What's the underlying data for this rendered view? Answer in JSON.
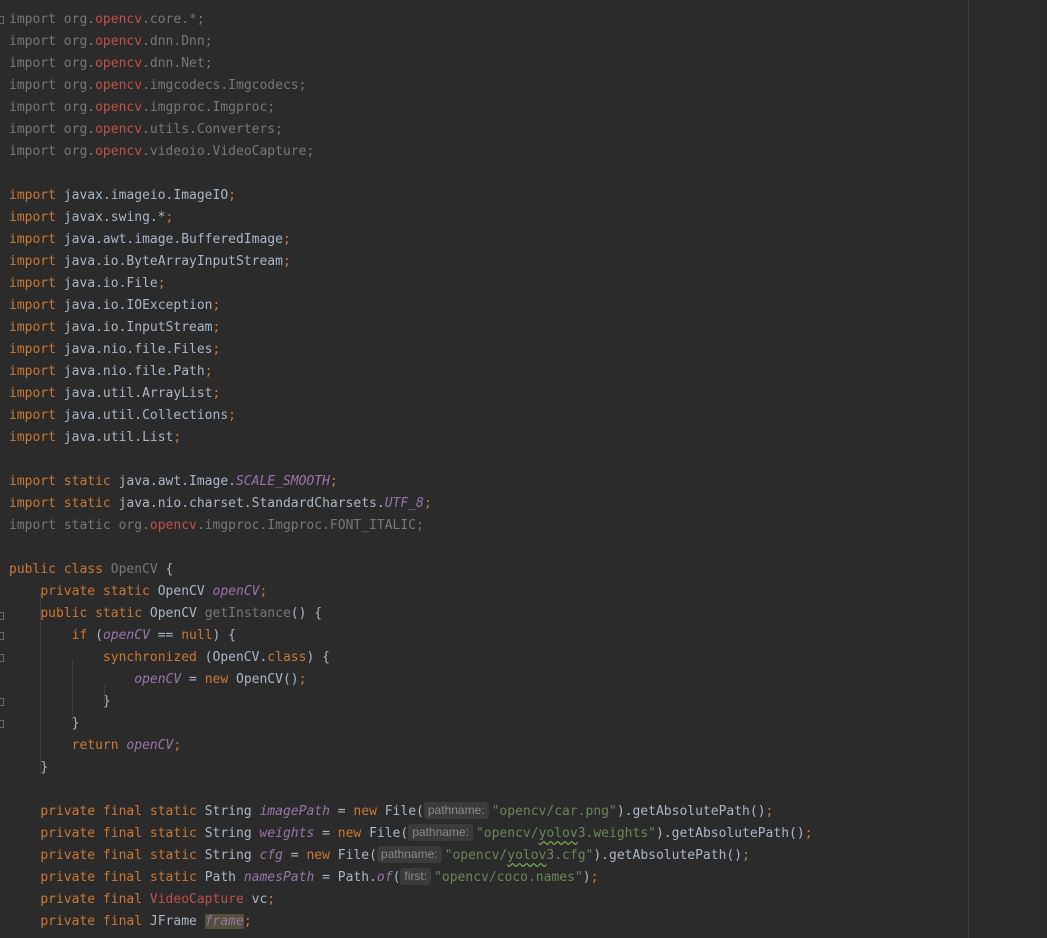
{
  "editor": {
    "lines": [
      [
        {
          "t": "import ",
          "c": "gray"
        },
        {
          "t": "org.",
          "c": "gray"
        },
        {
          "t": "opencv",
          "c": "ocv"
        },
        {
          "t": ".core.*;",
          "c": "gray"
        }
      ],
      [
        {
          "t": "import ",
          "c": "gray"
        },
        {
          "t": "org.",
          "c": "gray"
        },
        {
          "t": "opencv",
          "c": "ocv"
        },
        {
          "t": ".dnn.Dnn;",
          "c": "gray"
        }
      ],
      [
        {
          "t": "import ",
          "c": "gray"
        },
        {
          "t": "org.",
          "c": "gray"
        },
        {
          "t": "opencv",
          "c": "ocv"
        },
        {
          "t": ".dnn.Net;",
          "c": "gray"
        }
      ],
      [
        {
          "t": "import ",
          "c": "gray"
        },
        {
          "t": "org.",
          "c": "gray"
        },
        {
          "t": "opencv",
          "c": "ocv"
        },
        {
          "t": ".imgcodecs.Imgcodecs;",
          "c": "gray"
        }
      ],
      [
        {
          "t": "import ",
          "c": "gray"
        },
        {
          "t": "org.",
          "c": "gray"
        },
        {
          "t": "opencv",
          "c": "ocv"
        },
        {
          "t": ".imgproc.Imgproc;",
          "c": "gray"
        }
      ],
      [
        {
          "t": "import ",
          "c": "gray"
        },
        {
          "t": "org.",
          "c": "gray"
        },
        {
          "t": "opencv",
          "c": "ocv"
        },
        {
          "t": ".utils.Converters;",
          "c": "gray"
        }
      ],
      [
        {
          "t": "import ",
          "c": "gray"
        },
        {
          "t": "org.",
          "c": "gray"
        },
        {
          "t": "opencv",
          "c": "ocv"
        },
        {
          "t": ".videoio.VideoCapture;",
          "c": "gray"
        }
      ],
      [],
      [
        {
          "t": "import ",
          "c": "kw"
        },
        {
          "t": "javax.imageio.ImageIO",
          "c": "txt"
        },
        {
          "t": ";",
          "c": "punc"
        }
      ],
      [
        {
          "t": "import ",
          "c": "kw"
        },
        {
          "t": "javax.swing.*",
          "c": "txt"
        },
        {
          "t": ";",
          "c": "punc"
        }
      ],
      [
        {
          "t": "import ",
          "c": "kw"
        },
        {
          "t": "java.awt.image.BufferedImage",
          "c": "txt"
        },
        {
          "t": ";",
          "c": "punc"
        }
      ],
      [
        {
          "t": "import ",
          "c": "kw"
        },
        {
          "t": "java.io.ByteArrayInputStream",
          "c": "txt"
        },
        {
          "t": ";",
          "c": "punc"
        }
      ],
      [
        {
          "t": "import ",
          "c": "kw"
        },
        {
          "t": "java.io.File",
          "c": "txt"
        },
        {
          "t": ";",
          "c": "punc"
        }
      ],
      [
        {
          "t": "import ",
          "c": "kw"
        },
        {
          "t": "java.io.IOException",
          "c": "txt"
        },
        {
          "t": ";",
          "c": "punc"
        }
      ],
      [
        {
          "t": "import ",
          "c": "kw"
        },
        {
          "t": "java.io.InputStream",
          "c": "txt"
        },
        {
          "t": ";",
          "c": "punc"
        }
      ],
      [
        {
          "t": "import ",
          "c": "kw"
        },
        {
          "t": "java.nio.file.Files",
          "c": "txt"
        },
        {
          "t": ";",
          "c": "punc"
        }
      ],
      [
        {
          "t": "import ",
          "c": "kw"
        },
        {
          "t": "java.nio.file.Path",
          "c": "txt"
        },
        {
          "t": ";",
          "c": "punc"
        }
      ],
      [
        {
          "t": "import ",
          "c": "kw"
        },
        {
          "t": "java.util.ArrayList",
          "c": "txt"
        },
        {
          "t": ";",
          "c": "punc"
        }
      ],
      [
        {
          "t": "import ",
          "c": "kw"
        },
        {
          "t": "java.util.Collections",
          "c": "txt"
        },
        {
          "t": ";",
          "c": "punc"
        }
      ],
      [
        {
          "t": "import ",
          "c": "kw"
        },
        {
          "t": "java.util.List",
          "c": "txt"
        },
        {
          "t": ";",
          "c": "punc"
        }
      ],
      [],
      [
        {
          "t": "import static ",
          "c": "kw"
        },
        {
          "t": "java.awt.Image.",
          "c": "txt"
        },
        {
          "t": "SCALE_SMOOTH",
          "c": "fld"
        },
        {
          "t": ";",
          "c": "punc"
        }
      ],
      [
        {
          "t": "import static ",
          "c": "kw"
        },
        {
          "t": "java.nio.charset.StandardCharsets.",
          "c": "txt"
        },
        {
          "t": "UTF_8",
          "c": "fld"
        },
        {
          "t": ";",
          "c": "punc"
        }
      ],
      [
        {
          "t": "import static ",
          "c": "gray"
        },
        {
          "t": "org.",
          "c": "gray"
        },
        {
          "t": "opencv",
          "c": "ocv"
        },
        {
          "t": ".imgproc.Imgproc.FONT_ITALIC;",
          "c": "gray"
        }
      ],
      [],
      [
        {
          "t": "public class ",
          "c": "kw"
        },
        {
          "t": "OpenCV",
          "c": "gray"
        },
        {
          "t": " {",
          "c": "txt"
        }
      ],
      [
        {
          "t": "    "
        },
        {
          "t": "private static ",
          "c": "kw"
        },
        {
          "t": "OpenCV ",
          "c": "txt"
        },
        {
          "t": "openCV",
          "c": "fld"
        },
        {
          "t": ";",
          "c": "punc"
        }
      ],
      [
        {
          "t": "    "
        },
        {
          "t": "public static ",
          "c": "kw"
        },
        {
          "t": "OpenCV ",
          "c": "txt"
        },
        {
          "t": "getInstance",
          "c": "gray"
        },
        {
          "t": "() {",
          "c": "txt"
        }
      ],
      [
        {
          "t": "        "
        },
        {
          "t": "if ",
          "c": "kw"
        },
        {
          "t": "(",
          "c": "txt"
        },
        {
          "t": "openCV",
          "c": "fld"
        },
        {
          "t": " == ",
          "c": "txt"
        },
        {
          "t": "null",
          "c": "kw"
        },
        {
          "t": ") {",
          "c": "txt"
        }
      ],
      [
        {
          "t": "            "
        },
        {
          "t": "synchronized ",
          "c": "kw"
        },
        {
          "t": "(OpenCV.",
          "c": "txt"
        },
        {
          "t": "class",
          "c": "kw"
        },
        {
          "t": ") {",
          "c": "txt"
        }
      ],
      [
        {
          "t": "                "
        },
        {
          "t": "openCV",
          "c": "fld"
        },
        {
          "t": " = ",
          "c": "txt"
        },
        {
          "t": "new ",
          "c": "kw"
        },
        {
          "t": "OpenCV()",
          "c": "txt"
        },
        {
          "t": ";",
          "c": "punc"
        }
      ],
      [
        {
          "t": "            "
        },
        {
          "t": "}",
          "c": "txt"
        }
      ],
      [
        {
          "t": "        "
        },
        {
          "t": "}",
          "c": "txt"
        }
      ],
      [
        {
          "t": "        "
        },
        {
          "t": "return ",
          "c": "kw"
        },
        {
          "t": "openCV",
          "c": "fld"
        },
        {
          "t": ";",
          "c": "punc"
        }
      ],
      [
        {
          "t": "    "
        },
        {
          "t": "}",
          "c": "txt"
        }
      ],
      [],
      [
        {
          "t": "    "
        },
        {
          "t": "private final static ",
          "c": "kw"
        },
        {
          "t": "String ",
          "c": "txt"
        },
        {
          "t": "imagePath",
          "c": "fld"
        },
        {
          "t": " = ",
          "c": "txt"
        },
        {
          "t": "new ",
          "c": "kw"
        },
        {
          "t": "File(",
          "c": "txt"
        },
        {
          "h": "pathname:"
        },
        {
          "t": "\"opencv/car.png\"",
          "c": "str"
        },
        {
          "t": ").getAbsolutePath()",
          "c": "txt"
        },
        {
          "t": ";",
          "c": "punc"
        }
      ],
      [
        {
          "t": "    "
        },
        {
          "t": "private final static ",
          "c": "kw"
        },
        {
          "t": "String ",
          "c": "txt"
        },
        {
          "t": "weights",
          "c": "fld"
        },
        {
          "t": " = ",
          "c": "txt"
        },
        {
          "t": "new ",
          "c": "kw"
        },
        {
          "t": "File(",
          "c": "txt"
        },
        {
          "h": "pathname:"
        },
        {
          "t": "\"opencv/",
          "c": "str"
        },
        {
          "t": "yolov",
          "c": "str",
          "u": 1
        },
        {
          "t": "3.weights\"",
          "c": "str"
        },
        {
          "t": ").getAbsolutePath()",
          "c": "txt"
        },
        {
          "t": ";",
          "c": "punc"
        }
      ],
      [
        {
          "t": "    "
        },
        {
          "t": "private final static ",
          "c": "kw"
        },
        {
          "t": "String ",
          "c": "txt"
        },
        {
          "t": "cfg",
          "c": "fld"
        },
        {
          "t": " = ",
          "c": "txt"
        },
        {
          "t": "new ",
          "c": "kw"
        },
        {
          "t": "File(",
          "c": "txt"
        },
        {
          "h": "pathname:"
        },
        {
          "t": "\"opencv/",
          "c": "str"
        },
        {
          "t": "yolov",
          "c": "str",
          "u": 1
        },
        {
          "t": "3.cfg\"",
          "c": "str"
        },
        {
          "t": ").getAbsolutePath()",
          "c": "txt"
        },
        {
          "t": ";",
          "c": "punc"
        }
      ],
      [
        {
          "t": "    "
        },
        {
          "t": "private final static ",
          "c": "kw"
        },
        {
          "t": "Path ",
          "c": "txt"
        },
        {
          "t": "namesPath",
          "c": "fld"
        },
        {
          "t": " = ",
          "c": "txt"
        },
        {
          "t": "Path.",
          "c": "txt"
        },
        {
          "t": "of",
          "c": "fld"
        },
        {
          "t": "(",
          "c": "txt"
        },
        {
          "h": "first:"
        },
        {
          "t": "\"opencv/coco.names\"",
          "c": "str"
        },
        {
          "t": ")",
          "c": "txt"
        },
        {
          "t": ";",
          "c": "punc"
        }
      ],
      [
        {
          "t": "    "
        },
        {
          "t": "private final ",
          "c": "kw"
        },
        {
          "t": "VideoCapture ",
          "c": "ocv"
        },
        {
          "t": "vc",
          "c": "txt"
        },
        {
          "t": ";",
          "c": "punc"
        }
      ],
      [
        {
          "t": "    "
        },
        {
          "t": "private final ",
          "c": "kw"
        },
        {
          "t": "JFrame ",
          "c": "txt"
        },
        {
          "t": "frame",
          "c": "fld",
          "hl": 1
        },
        {
          "t": ";",
          "c": "punc"
        }
      ]
    ]
  }
}
